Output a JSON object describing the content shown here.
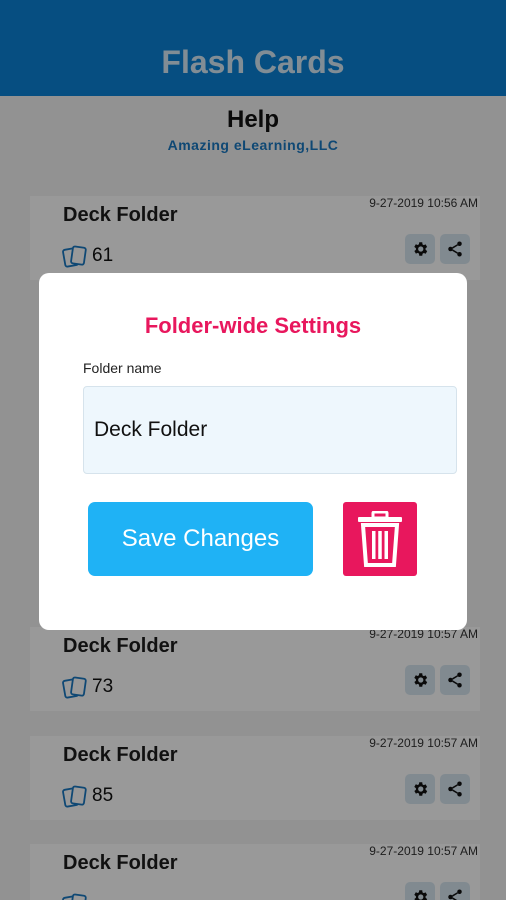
{
  "header": {
    "title": "Flash Cards"
  },
  "help": {
    "title": "Help",
    "company": "Amazing eLearning,LLC"
  },
  "decks": [
    {
      "title": "Deck Folder",
      "date": "9-27-2019 10:56 AM",
      "count": "61"
    },
    {
      "title": "Deck Folder",
      "date": "9-27-2019 10:57 AM",
      "count": "73"
    },
    {
      "title": "Deck Folder",
      "date": "9-27-2019 10:57 AM",
      "count": "85"
    },
    {
      "title": "Deck Folder",
      "date": "9-27-2019 10:57 AM",
      "count": ""
    }
  ],
  "modal": {
    "title": "Folder-wide Settings",
    "field_label": "Folder name",
    "field_value": "Deck Folder",
    "save_label": "Save Changes",
    "delete_icon": "trash-icon"
  },
  "icons": {
    "cards": "cards-icon",
    "settings": "gear-icon",
    "share": "share-icon"
  },
  "colors": {
    "accent_blue": "#0a83d8",
    "save_button": "#1fb2f5",
    "danger": "#e8175d",
    "company_text": "#1a78c2"
  }
}
